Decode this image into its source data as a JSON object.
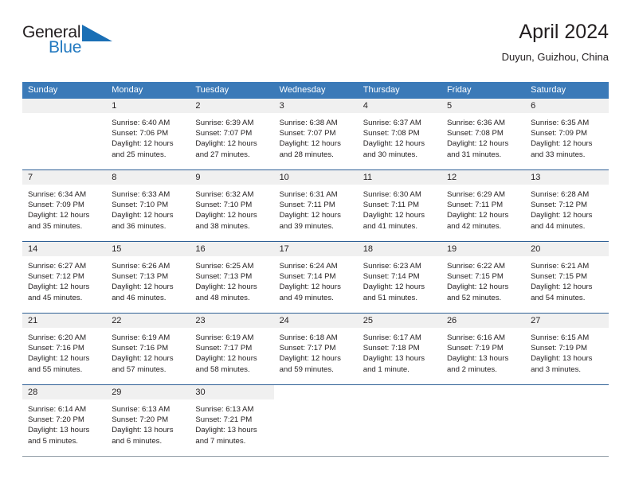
{
  "brand": {
    "name_part1": "General",
    "name_part2": "Blue",
    "triangle_icon": "triangle-icon",
    "accent_color": "#2279c0"
  },
  "header": {
    "title": "April 2024",
    "subtitle": "Duyun, Guizhou, China"
  },
  "theme": {
    "header_blue": "#3b7ab8",
    "row_divider": "#2f6096",
    "daynum_band": "#f0f0f0",
    "text": "#231f20"
  },
  "calendar": {
    "weekday_headers": [
      "Sunday",
      "Monday",
      "Tuesday",
      "Wednesday",
      "Thursday",
      "Friday",
      "Saturday"
    ],
    "weeks": [
      [
        {
          "day": "",
          "lines": []
        },
        {
          "day": "1",
          "lines": [
            "Sunrise: 6:40 AM",
            "Sunset: 7:06 PM",
            "Daylight: 12 hours",
            "and 25 minutes."
          ]
        },
        {
          "day": "2",
          "lines": [
            "Sunrise: 6:39 AM",
            "Sunset: 7:07 PM",
            "Daylight: 12 hours",
            "and 27 minutes."
          ]
        },
        {
          "day": "3",
          "lines": [
            "Sunrise: 6:38 AM",
            "Sunset: 7:07 PM",
            "Daylight: 12 hours",
            "and 28 minutes."
          ]
        },
        {
          "day": "4",
          "lines": [
            "Sunrise: 6:37 AM",
            "Sunset: 7:08 PM",
            "Daylight: 12 hours",
            "and 30 minutes."
          ]
        },
        {
          "day": "5",
          "lines": [
            "Sunrise: 6:36 AM",
            "Sunset: 7:08 PM",
            "Daylight: 12 hours",
            "and 31 minutes."
          ]
        },
        {
          "day": "6",
          "lines": [
            "Sunrise: 6:35 AM",
            "Sunset: 7:09 PM",
            "Daylight: 12 hours",
            "and 33 minutes."
          ]
        }
      ],
      [
        {
          "day": "7",
          "lines": [
            "Sunrise: 6:34 AM",
            "Sunset: 7:09 PM",
            "Daylight: 12 hours",
            "and 35 minutes."
          ]
        },
        {
          "day": "8",
          "lines": [
            "Sunrise: 6:33 AM",
            "Sunset: 7:10 PM",
            "Daylight: 12 hours",
            "and 36 minutes."
          ]
        },
        {
          "day": "9",
          "lines": [
            "Sunrise: 6:32 AM",
            "Sunset: 7:10 PM",
            "Daylight: 12 hours",
            "and 38 minutes."
          ]
        },
        {
          "day": "10",
          "lines": [
            "Sunrise: 6:31 AM",
            "Sunset: 7:11 PM",
            "Daylight: 12 hours",
            "and 39 minutes."
          ]
        },
        {
          "day": "11",
          "lines": [
            "Sunrise: 6:30 AM",
            "Sunset: 7:11 PM",
            "Daylight: 12 hours",
            "and 41 minutes."
          ]
        },
        {
          "day": "12",
          "lines": [
            "Sunrise: 6:29 AM",
            "Sunset: 7:11 PM",
            "Daylight: 12 hours",
            "and 42 minutes."
          ]
        },
        {
          "day": "13",
          "lines": [
            "Sunrise: 6:28 AM",
            "Sunset: 7:12 PM",
            "Daylight: 12 hours",
            "and 44 minutes."
          ]
        }
      ],
      [
        {
          "day": "14",
          "lines": [
            "Sunrise: 6:27 AM",
            "Sunset: 7:12 PM",
            "Daylight: 12 hours",
            "and 45 minutes."
          ]
        },
        {
          "day": "15",
          "lines": [
            "Sunrise: 6:26 AM",
            "Sunset: 7:13 PM",
            "Daylight: 12 hours",
            "and 46 minutes."
          ]
        },
        {
          "day": "16",
          "lines": [
            "Sunrise: 6:25 AM",
            "Sunset: 7:13 PM",
            "Daylight: 12 hours",
            "and 48 minutes."
          ]
        },
        {
          "day": "17",
          "lines": [
            "Sunrise: 6:24 AM",
            "Sunset: 7:14 PM",
            "Daylight: 12 hours",
            "and 49 minutes."
          ]
        },
        {
          "day": "18",
          "lines": [
            "Sunrise: 6:23 AM",
            "Sunset: 7:14 PM",
            "Daylight: 12 hours",
            "and 51 minutes."
          ]
        },
        {
          "day": "19",
          "lines": [
            "Sunrise: 6:22 AM",
            "Sunset: 7:15 PM",
            "Daylight: 12 hours",
            "and 52 minutes."
          ]
        },
        {
          "day": "20",
          "lines": [
            "Sunrise: 6:21 AM",
            "Sunset: 7:15 PM",
            "Daylight: 12 hours",
            "and 54 minutes."
          ]
        }
      ],
      [
        {
          "day": "21",
          "lines": [
            "Sunrise: 6:20 AM",
            "Sunset: 7:16 PM",
            "Daylight: 12 hours",
            "and 55 minutes."
          ]
        },
        {
          "day": "22",
          "lines": [
            "Sunrise: 6:19 AM",
            "Sunset: 7:16 PM",
            "Daylight: 12 hours",
            "and 57 minutes."
          ]
        },
        {
          "day": "23",
          "lines": [
            "Sunrise: 6:19 AM",
            "Sunset: 7:17 PM",
            "Daylight: 12 hours",
            "and 58 minutes."
          ]
        },
        {
          "day": "24",
          "lines": [
            "Sunrise: 6:18 AM",
            "Sunset: 7:17 PM",
            "Daylight: 12 hours",
            "and 59 minutes."
          ]
        },
        {
          "day": "25",
          "lines": [
            "Sunrise: 6:17 AM",
            "Sunset: 7:18 PM",
            "Daylight: 13 hours",
            "and 1 minute."
          ]
        },
        {
          "day": "26",
          "lines": [
            "Sunrise: 6:16 AM",
            "Sunset: 7:19 PM",
            "Daylight: 13 hours",
            "and 2 minutes."
          ]
        },
        {
          "day": "27",
          "lines": [
            "Sunrise: 6:15 AM",
            "Sunset: 7:19 PM",
            "Daylight: 13 hours",
            "and 3 minutes."
          ]
        }
      ],
      [
        {
          "day": "28",
          "lines": [
            "Sunrise: 6:14 AM",
            "Sunset: 7:20 PM",
            "Daylight: 13 hours",
            "and 5 minutes."
          ]
        },
        {
          "day": "29",
          "lines": [
            "Sunrise: 6:13 AM",
            "Sunset: 7:20 PM",
            "Daylight: 13 hours",
            "and 6 minutes."
          ]
        },
        {
          "day": "30",
          "lines": [
            "Sunrise: 6:13 AM",
            "Sunset: 7:21 PM",
            "Daylight: 13 hours",
            "and 7 minutes."
          ]
        },
        {
          "day": "",
          "lines": []
        },
        {
          "day": "",
          "lines": []
        },
        {
          "day": "",
          "lines": []
        },
        {
          "day": "",
          "lines": []
        }
      ]
    ]
  }
}
